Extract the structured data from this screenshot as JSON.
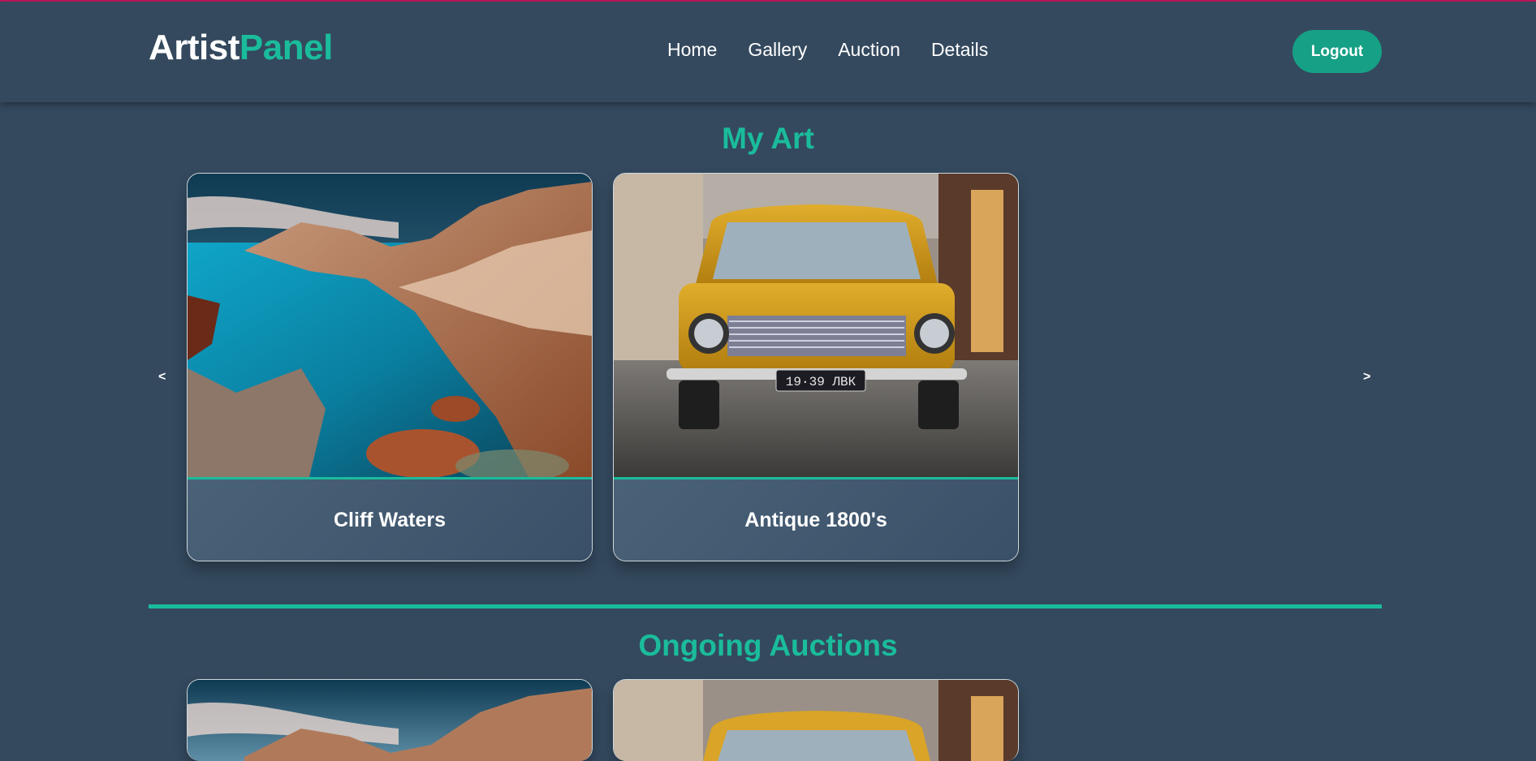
{
  "brand": {
    "part1": "Artist",
    "part2": "Panel"
  },
  "nav": {
    "links": [
      "Home",
      "Gallery",
      "Auction",
      "Details"
    ],
    "logout_label": "Logout"
  },
  "my_art": {
    "title": "My Art",
    "prev_label": "<",
    "next_label": ">",
    "cards": [
      {
        "caption": "Cliff Waters"
      },
      {
        "caption": "Antique 1800's"
      }
    ]
  },
  "auctions": {
    "title": "Ongoing Auctions"
  },
  "colors": {
    "background": "#34495e",
    "accent": "#1abc9c",
    "button": "#16a085",
    "top_line": "#c2185b"
  },
  "plate_text": "19·39 ЛВК"
}
